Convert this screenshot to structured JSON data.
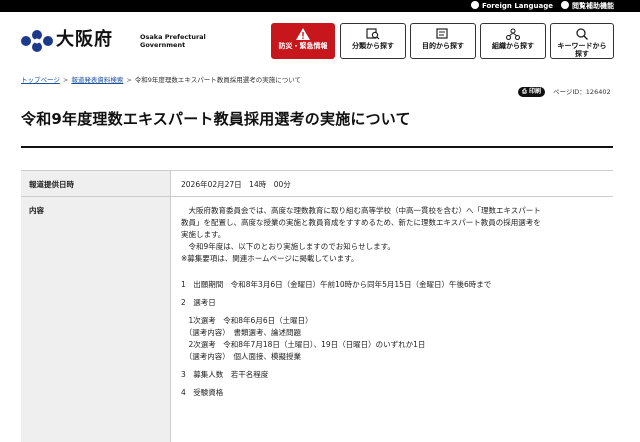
{
  "topbar": {
    "foreign_language": "Foreign Language",
    "reading_aid": "閲覧補助機能"
  },
  "header": {
    "logo_name": "大阪府",
    "logo_en_line1": "Osaka Prefectural",
    "logo_en_line2": "Government",
    "nav": [
      {
        "label": "防災・緊急情報"
      },
      {
        "label": "分類から探す"
      },
      {
        "label": "目的から探す"
      },
      {
        "label": "組織から探す"
      },
      {
        "label_line1": "キーワードから",
        "label_line2": "探す"
      }
    ]
  },
  "breadcrumb": {
    "home": "トップページ",
    "press": "報道発表資料検索",
    "current": "令和9年度理数エキスパート教員採用選考の実施について"
  },
  "print_label": "印刷",
  "page_id": "ページID：126402",
  "title": "令和9年度理数エキスパート教員採用選考の実施について",
  "table": {
    "date_label": "報道提供日時",
    "date_value": "2026年02月27日　14時　00分",
    "content_label": "内容",
    "content_lines": [
      "　大阪府教育委員会では、高度な理数教育に取り組む高等学校（中高一貫校を含む）へ「理数エキスパート",
      "教員」を配置し、高度な授業の実施と教員育成をすすめるため、新たに理数エキスパート教員の採用選考を",
      "実施します。",
      "　令和9年度は、以下のとおり実施しますのでお知らせします。",
      "※募集要項は、関連ホームページに掲載しています。"
    ],
    "items": [
      "1　出願期間　令和8年3月6日（金曜日）午前10時から同年5月15日（金曜日）午後6時まで",
      "2　選考日",
      "　1次選考　令和8年6月6日（土曜日）",
      "　（選考内容）　書類選考、論述問題",
      "　2次選考　令和8年7月18日（土曜日）、19日（日曜日）のいずれか1日",
      "　（選考内容）　個人面接、模擬授業",
      "3　募集人数　若干名程度",
      "4　受験資格"
    ]
  }
}
